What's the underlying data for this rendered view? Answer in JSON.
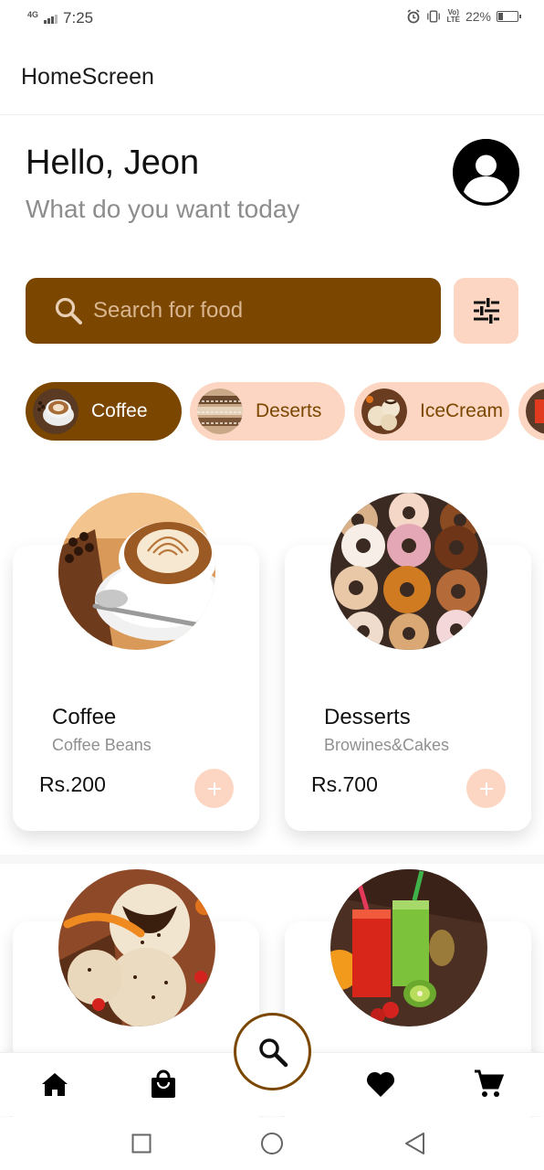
{
  "status_bar": {
    "network": "4G",
    "time": "7:25",
    "lte_top": "Vo)",
    "lte_bottom": "LTE",
    "battery": "22%"
  },
  "app_bar": {
    "title": "HomeScreen"
  },
  "greeting": {
    "hello": "Hello,",
    "name": "Jeon",
    "subtitle": "What do you want today"
  },
  "search": {
    "placeholder": "Search for food"
  },
  "categories": [
    {
      "label": "Coffee",
      "active": true
    },
    {
      "label": "Deserts",
      "active": false
    },
    {
      "label": "IceCream",
      "active": false
    },
    {
      "label": "",
      "active": false
    }
  ],
  "products": [
    {
      "name": "Coffee",
      "desc": "Coffee Beans",
      "price": "Rs.200"
    },
    {
      "name": "Desserts",
      "desc": "Browines&Cakes",
      "price": "Rs.700"
    },
    {
      "name": "",
      "desc": "",
      "price": ""
    },
    {
      "name": "",
      "desc": "",
      "price": ""
    }
  ],
  "bottom_nav": {
    "items": [
      "home-icon",
      "shopping-bag-icon",
      "search-icon",
      "heart-icon",
      "cart-icon"
    ]
  },
  "colors": {
    "primary": "#7b4700",
    "accent_light": "#fcd6c3",
    "subtitle": "#8d8d8d"
  }
}
